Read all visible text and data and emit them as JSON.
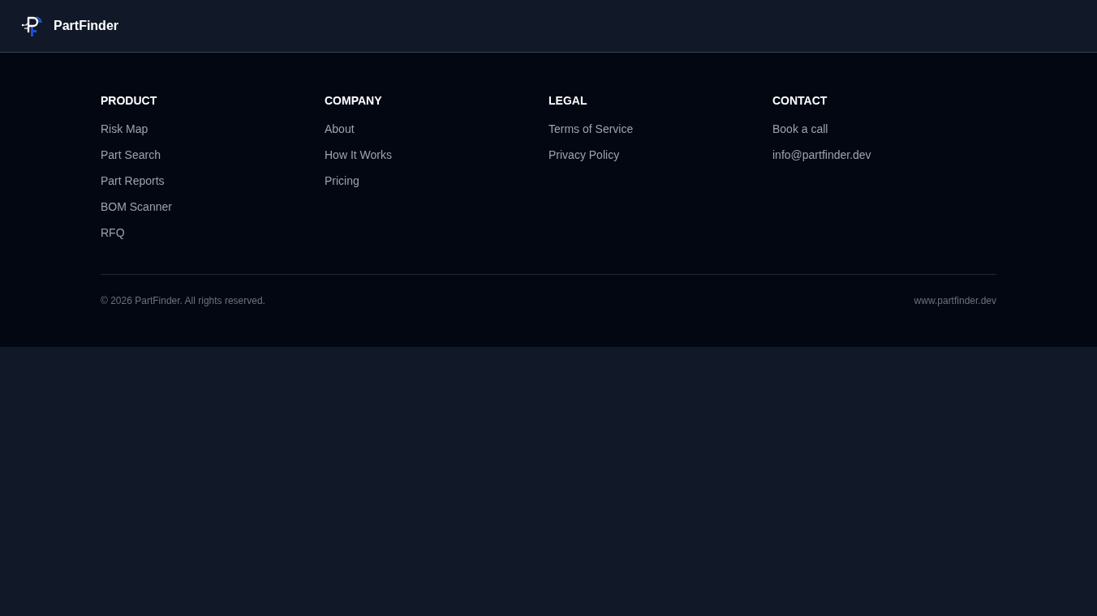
{
  "header": {
    "brand": "PartFinder"
  },
  "footer": {
    "columns": [
      {
        "heading": "PRODUCT",
        "links": [
          "Risk Map",
          "Part Search",
          "Part Reports",
          "BOM Scanner",
          "RFQ"
        ]
      },
      {
        "heading": "COMPANY",
        "links": [
          "About",
          "How It Works",
          "Pricing"
        ]
      },
      {
        "heading": "LEGAL",
        "links": [
          "Terms of Service",
          "Privacy Policy"
        ]
      },
      {
        "heading": "CONTACT",
        "links": [
          "Book a call",
          "info@partfinder.dev"
        ]
      }
    ],
    "copyright": "© 2026 PartFinder. All rights reserved.",
    "website": "www.partfinder.dev"
  }
}
